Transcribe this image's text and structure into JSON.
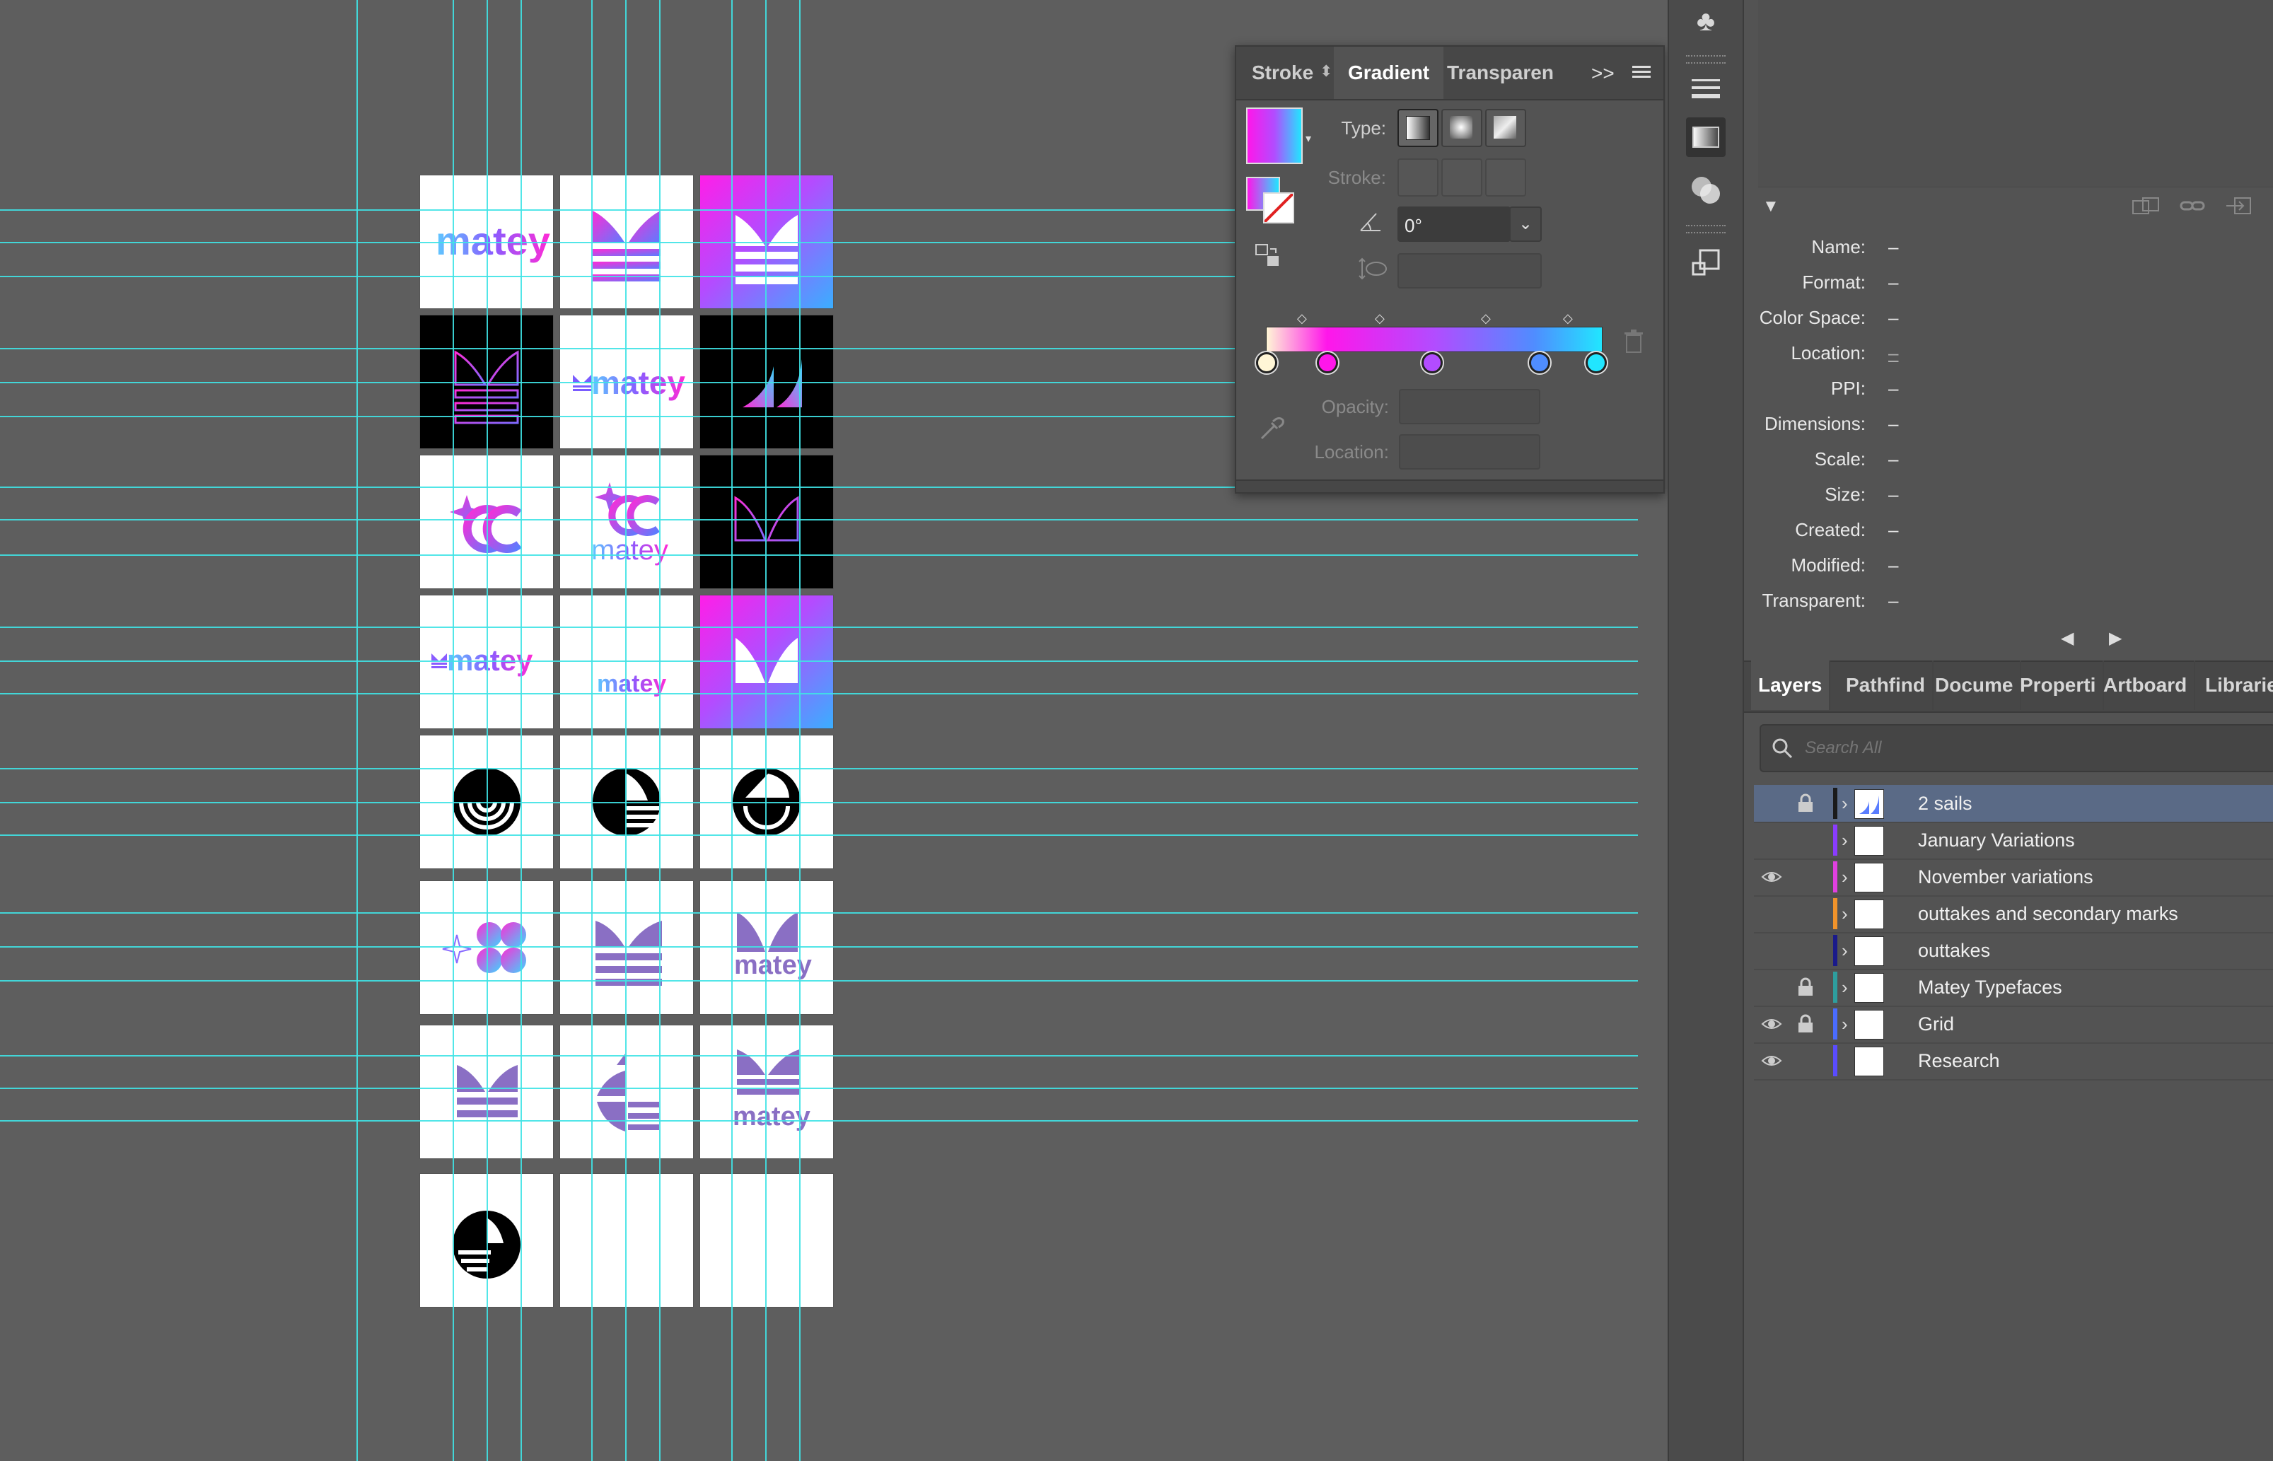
{
  "canvas": {
    "artboard_logos": {
      "r1c1": "matey",
      "r2c2": "matey",
      "r3c2": "matey",
      "r4c1": "matey",
      "r4c2": "matey",
      "r6c3": "matey",
      "r7c3": "matey"
    }
  },
  "gradient_panel": {
    "tabs": [
      "Stroke",
      "Gradient",
      "Transparen"
    ],
    "active_tab": "Gradient",
    "overflow": ">>",
    "type_label": "Type:",
    "stroke_label": "Stroke:",
    "angle_value": "0°",
    "opacity_label": "Opacity:",
    "location_label": "Location:",
    "gradient_colors": [
      "#fff6d6",
      "#ff16ea",
      "#b24cff",
      "#4f8dff",
      "#21e6ff"
    ]
  },
  "info_panel": {
    "fields": [
      {
        "label": "Name:",
        "value": "–"
      },
      {
        "label": "Format:",
        "value": "–"
      },
      {
        "label": "Color Space:",
        "value": "–"
      },
      {
        "label": "Location:",
        "value": "–"
      },
      {
        "label": "PPI:",
        "value": "–"
      },
      {
        "label": "Dimensions:",
        "value": "–"
      },
      {
        "label": "Scale:",
        "value": "–"
      },
      {
        "label": "Size:",
        "value": "–"
      },
      {
        "label": "Created:",
        "value": "–"
      },
      {
        "label": "Modified:",
        "value": "–"
      },
      {
        "label": "Transparent:",
        "value": "–"
      }
    ]
  },
  "layers_panel": {
    "tabs": [
      "Layers",
      "Pathfind",
      "Docume",
      "Properti",
      "Artboard",
      "Librarie"
    ],
    "active_tab": "Layers",
    "search_placeholder": "Search All",
    "layers": [
      {
        "name": "2 sails",
        "color": "#2b2b2b",
        "visible": false,
        "locked": true,
        "selected": true
      },
      {
        "name": "January Variations",
        "color": "#8a3cff",
        "visible": false,
        "locked": false,
        "selected": false
      },
      {
        "name": "November variations",
        "color": "#e040e0",
        "visible": true,
        "locked": false,
        "selected": false
      },
      {
        "name": "outtakes and secondary marks",
        "color": "#f0932b",
        "visible": false,
        "locked": false,
        "selected": false
      },
      {
        "name": "outtakes",
        "color": "#1a1a8a",
        "visible": false,
        "locked": false,
        "selected": false
      },
      {
        "name": "Matey Typefaces",
        "color": "#2e9e9e",
        "visible": false,
        "locked": true,
        "selected": false
      },
      {
        "name": "Grid",
        "color": "#4a6cff",
        "visible": true,
        "locked": true,
        "selected": false
      },
      {
        "name": "Research",
        "color": "#5a4cff",
        "visible": true,
        "locked": false,
        "selected": false
      }
    ]
  }
}
